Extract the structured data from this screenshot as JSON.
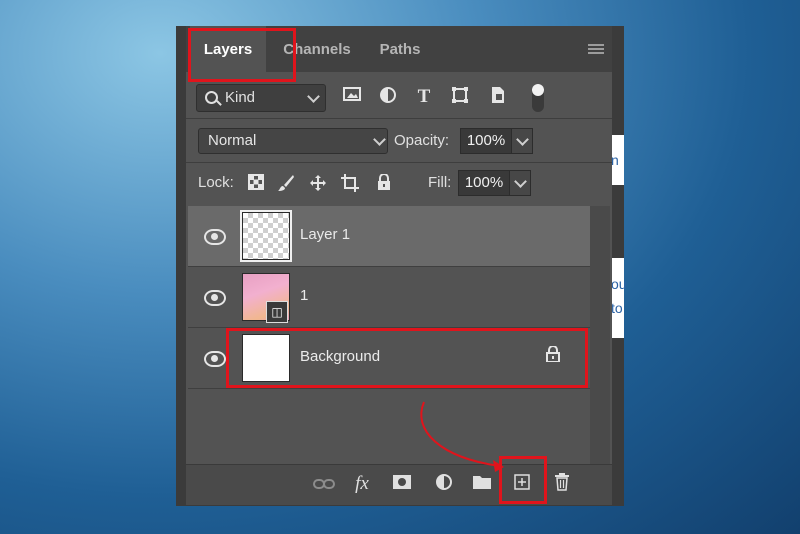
{
  "tabs": [
    {
      "label": "Layers",
      "active": true
    },
    {
      "label": "Channels",
      "active": false
    },
    {
      "label": "Paths",
      "active": false
    }
  ],
  "filter": {
    "kind_label": "Kind",
    "icons": [
      "image-icon",
      "adjustment-icon",
      "type-icon",
      "shape-icon",
      "smart-object-icon"
    ]
  },
  "blend": {
    "mode": "Normal",
    "opacity_label": "Opacity:",
    "opacity_value": "100%"
  },
  "lock": {
    "label": "Lock:",
    "fill_label": "Fill:",
    "fill_value": "100%"
  },
  "layers": [
    {
      "name": "Layer 1",
      "selected": true,
      "thumb": "transparent"
    },
    {
      "name": "1",
      "selected": false,
      "thumb": "smart-object"
    },
    {
      "name": "Background",
      "selected": false,
      "thumb": "white",
      "locked": true
    }
  ],
  "bottom_bar": {
    "fx_label": "fx"
  },
  "peek_text": [
    "n",
    "ou",
    "to"
  ],
  "highlight_color": "#e0141c"
}
